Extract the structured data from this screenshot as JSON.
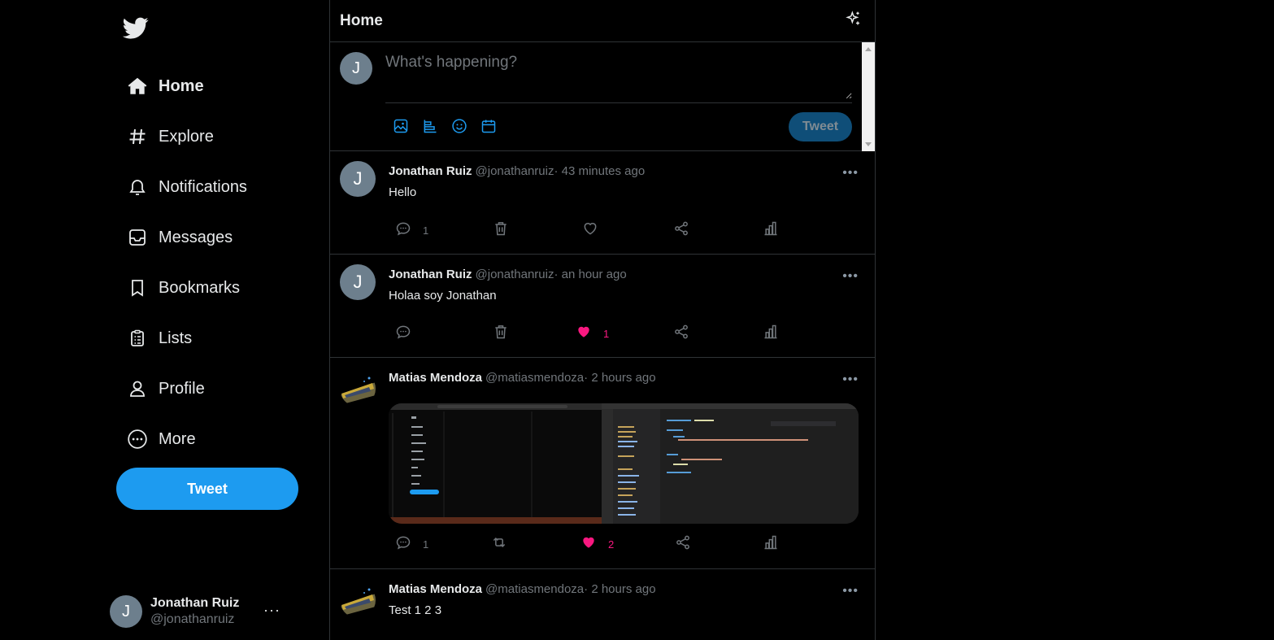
{
  "sidebar": {
    "logo": "twitter-bird-icon",
    "nav": [
      {
        "label": "Home",
        "icon": "home-icon"
      },
      {
        "label": "Explore",
        "icon": "hashtag-icon"
      },
      {
        "label": "Notifications",
        "icon": "bell-icon"
      },
      {
        "label": "Messages",
        "icon": "inbox-icon"
      },
      {
        "label": "Bookmarks",
        "icon": "bookmark-icon"
      },
      {
        "label": "Lists",
        "icon": "list-icon"
      },
      {
        "label": "Profile",
        "icon": "user-icon"
      },
      {
        "label": "More",
        "icon": "more-circle-icon"
      }
    ],
    "tweet_button": "Tweet",
    "account": {
      "initial": "J",
      "display_name": "Jonathan Ruiz",
      "handle": "@jonathanruiz",
      "menu": "···"
    }
  },
  "header": {
    "title": "Home",
    "icon": "sparkle-icon"
  },
  "composer": {
    "avatar_initial": "J",
    "placeholder": "What's happening?",
    "tools": [
      "image-icon",
      "poll-icon",
      "emoji-icon",
      "schedule-icon"
    ],
    "tweet_button": "Tweet"
  },
  "tweets": [
    {
      "initial": "J",
      "display_name": "Jonathan Ruiz",
      "handle": "@jonathanruiz",
      "time": "· 43 minutes ago",
      "text": "Hello",
      "reply_count": "1",
      "like_count": "",
      "liked": false
    },
    {
      "initial": "J",
      "display_name": "Jonathan Ruiz",
      "handle": "@jonathanruiz",
      "time": "· an hour ago",
      "text": "Holaa soy Jonathan",
      "reply_count": "",
      "like_count": "1",
      "liked": true
    },
    {
      "initial": "",
      "display_name": "Matias Mendoza",
      "handle": "@matiasmendoza",
      "time": "· 2 hours ago",
      "text": "",
      "reply_count": "1",
      "like_count": "2",
      "liked": true
    },
    {
      "initial": "",
      "display_name": "Matias Mendoza",
      "handle": "@matiasmendoza",
      "time": "· 2 hours ago",
      "text": "Test 1 2 3",
      "reply_count": "",
      "like_count": "",
      "liked": false
    }
  ],
  "colors": {
    "accent": "#1d9bf0",
    "like": "#f91880",
    "muted": "#71767b",
    "border": "#2f3336"
  }
}
